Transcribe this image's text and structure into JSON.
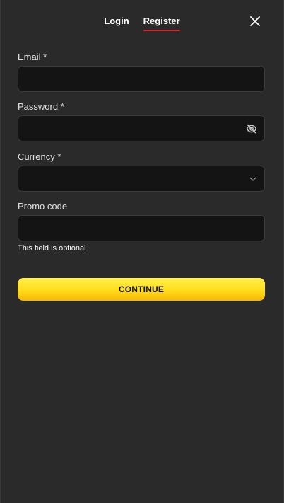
{
  "tabs": [
    {
      "label": "Login",
      "active": false
    },
    {
      "label": "Register",
      "active": true
    }
  ],
  "icons": {
    "close": "close-icon",
    "password_toggle": "eye-off-icon",
    "currency_dropdown": "chevron-down-icon"
  },
  "form": {
    "email": {
      "label": "Email *",
      "value": "",
      "placeholder": ""
    },
    "password": {
      "label": "Password *",
      "value": "",
      "placeholder": ""
    },
    "currency": {
      "label": "Currency *",
      "value": ""
    },
    "promo": {
      "label": "Promo code",
      "value": "",
      "placeholder": "",
      "hint": "This field is optional"
    }
  },
  "continue_label": "CONTINUE",
  "colors": {
    "background": "#2a2a2a",
    "field_background": "#141414",
    "tab_underline": "#d6262f",
    "button_top": "#fff04a",
    "button_bottom": "#f6b800"
  }
}
